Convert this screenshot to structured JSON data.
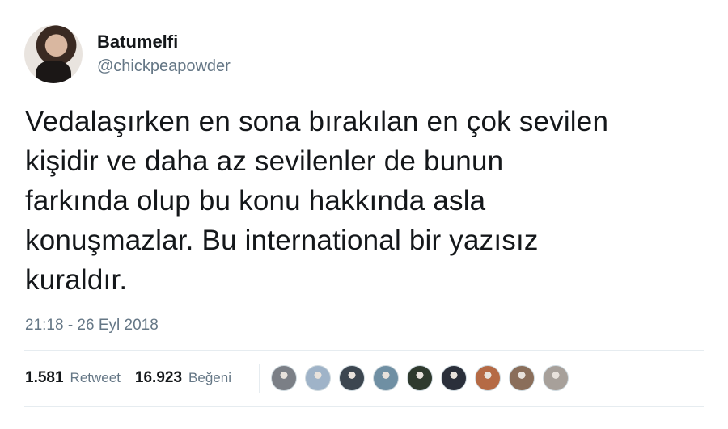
{
  "user": {
    "display_name": "Batumelfi",
    "handle": "@chickpeapowder"
  },
  "tweet": {
    "text": "Vedalaşırken en sona bırakılan en çok sevilen\nkişidir ve daha az sevilenler de bunun\nfarkında olup bu konu hakkında asla\nkonuşmazlar. Bu international bir yazısız\nkuraldır.",
    "timestamp": "21:18 - 26 Eyl 2018"
  },
  "stats": {
    "retweet_count": "1.581",
    "retweet_label": "Retweet",
    "like_count": "16.923",
    "like_label": "Beğeni"
  },
  "likers": [
    {
      "icon": "avatar-icon",
      "color": "#7b7f86"
    },
    {
      "icon": "avatar-icon",
      "color": "#9fb3c8"
    },
    {
      "icon": "avatar-icon",
      "color": "#3c4650"
    },
    {
      "icon": "avatar-icon",
      "color": "#6f8fa3"
    },
    {
      "icon": "avatar-icon",
      "color": "#2f3a2e"
    },
    {
      "icon": "avatar-icon",
      "color": "#2a2f3a"
    },
    {
      "icon": "avatar-icon",
      "color": "#b56a45"
    },
    {
      "icon": "avatar-icon",
      "color": "#8a6e5a"
    },
    {
      "icon": "avatar-icon",
      "color": "#a7a09a"
    }
  ]
}
